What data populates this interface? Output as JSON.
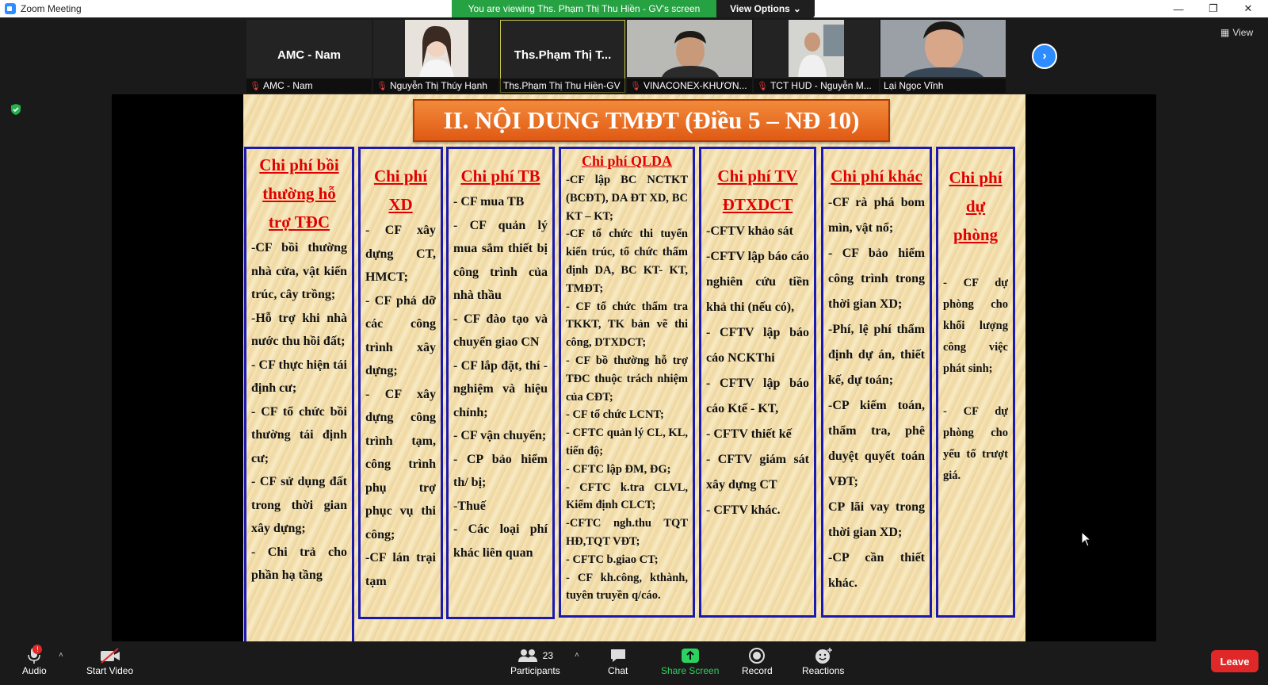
{
  "window": {
    "title": "Zoom Meeting",
    "minimize": "—",
    "restore": "❐",
    "close": "✕"
  },
  "banner": {
    "viewing_text": "You are viewing Ths. Phạm Thị Thu Hiền - GV's screen",
    "view_options_label": "View Options",
    "view_options_chevron": "⌄"
  },
  "participants_strip": [
    {
      "display_name": "AMC - Nam",
      "label": "AMC - Nam",
      "has_video": false,
      "muted": true
    },
    {
      "display_name": "",
      "label": "Nguyễn Thị Thúy Hạnh",
      "has_video": true,
      "muted": true
    },
    {
      "display_name": "Ths.Phạm Thị T...",
      "label": "Ths.Phạm Thị Thu Hiền-GV",
      "has_video": false,
      "muted": false,
      "active": true
    },
    {
      "display_name": "",
      "label": "VINACONEX-KHƯƠN...",
      "has_video": true,
      "muted": true
    },
    {
      "display_name": "",
      "label": "TCT HUD - Nguyễn M...",
      "has_video": true,
      "muted": true
    },
    {
      "display_name": "",
      "label": "Lại Ngọc Vĩnh",
      "has_video": true,
      "muted": false
    }
  ],
  "strip_next_icon": "›",
  "view_button_label": "View",
  "slide": {
    "title": "II. NỘI DUNG TMĐT (Điều 5 – NĐ 10)",
    "columns": [
      {
        "heading": [
          "Chi phí bồi",
          "thường hỗ",
          "trợ TĐC"
        ],
        "items": [
          "-CF bồi thường nhà cửa, vật kiến trúc, cây trồng;",
          "-Hỗ trợ khi nhà nước thu hồi đất;",
          "- CF thực hiện tái định cư;",
          "- CF tổ chức bồi thường tái định cư;",
          "- CF sử dụng đất trong thời gian xây dựng;",
          "- Chi trả cho phần hạ tầng"
        ]
      },
      {
        "heading": [
          "Chi phí",
          "XD"
        ],
        "items": [
          "- CF xây dựng CT, HMCT;",
          "- CF phá dỡ các công trình xây dựng;",
          "- CF xây dựng công trình tạm, công trình phụ trợ phục vụ thi công;",
          "-CF lán trại tạm"
        ]
      },
      {
        "heading": [
          "Chi phí TB"
        ],
        "items": [
          "- CF mua TB",
          "- CF quản lý mua sắm thiết bị công trình của nhà thầu",
          "- CF đào tạo và chuyển giao CN",
          "- CF lắp đặt, thí -nghiệm và hiệu chỉnh;",
          "- CF vận chuyển;",
          "- CP bảo hiểm th/ bị;",
          "-Thuế",
          "- Các loại phí khác liên quan"
        ]
      },
      {
        "heading": [
          "Chi phí QLDA"
        ],
        "items": [
          "-CF lập BC NCTKT (BCĐT), DA ĐT XD, BC KT – KT;",
          "-CF tổ chức thi tuyển kiến trúc, tổ chức thẩm định DA, BC KT- KT, TMĐT;",
          "- CF tổ chức thẩm tra TKKT, TK bản vẽ thi công, DTXDCT;",
          "- CF bồ thường hỗ trợ TĐC thuộc trách nhiệm của CĐT;",
          "- CF tổ chức LCNT;",
          "- CFTC quản lý CL, KL, tiến độ;",
          "- CFTC lập ĐM, ĐG;",
          "- CFTC k.tra CLVL, Kiểm định CLCT;",
          "-CFTC ngh.thu TQT HĐ,TQT VĐT;",
          "- CFTC b.giao CT;",
          "- CF kh.công, kthành, tuyên truyền q/cáo."
        ]
      },
      {
        "heading": [
          "Chi phí TV",
          "ĐTXDCT"
        ],
        "items": [
          "-CFTV khảo sát",
          "-CFTV lập báo cáo nghiên cứu tiền khả thi (nếu có),",
          "- CFTV lập báo cáo NCKThi",
          "- CFTV lập báo cáo Ktế - KT,",
          "- CFTV thiết kế",
          "- CFTV giám sát xây dựng CT",
          "- CFTV khác."
        ]
      },
      {
        "heading": [
          "Chi phí khác"
        ],
        "items": [
          "-CF rà phá bom mìn, vật nổ;",
          "- CF bảo hiểm công trình trong thời gian XD;",
          "-Phí, lệ phí thẩm định dự án, thiết kế, dự toán;",
          "-CP kiểm toán, thẩm tra, phê duyệt quyết toán VĐT;",
          "CP lãi vay trong thời gian XD;",
          "-CP cần thiết khác."
        ]
      },
      {
        "heading": [
          "Chi phí",
          "dự",
          "phòng"
        ],
        "items": [
          "- CF dự phòng cho khối lượng công việc phát sinh;",
          "- CF dự phòng cho yếu tố trượt giá."
        ]
      }
    ]
  },
  "toolbar": {
    "audio_label": "Audio",
    "audio_badge": "!",
    "start_video_label": "Start Video",
    "participants_label": "Participants",
    "participants_count": "23",
    "chat_label": "Chat",
    "share_screen_label": "Share Screen",
    "record_label": "Record",
    "reactions_label": "Reactions",
    "leave_label": "Leave",
    "caret": "˄"
  },
  "colors": {
    "banner_green": "#26a243",
    "zoom_blue": "#2d8cff",
    "leave_red": "#e02828",
    "slide_heading_red": "#e00000",
    "slide_border_blue": "#1a1ab0",
    "slide_title_orange": "#e05a14"
  }
}
